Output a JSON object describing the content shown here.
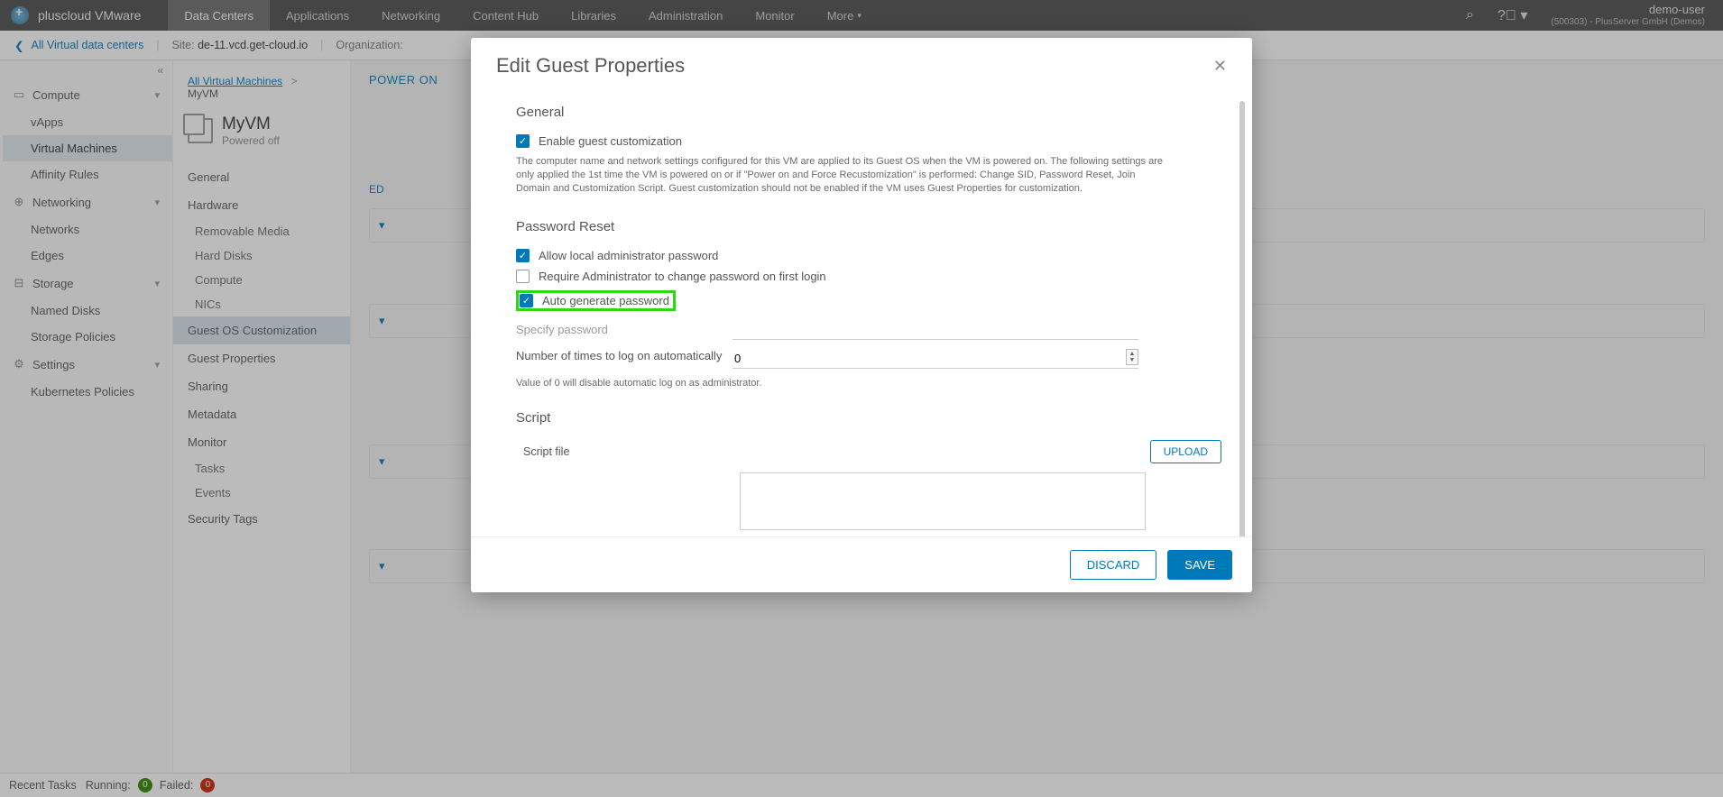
{
  "brand": "pluscloud VMware",
  "nav": {
    "tabs": [
      "Data Centers",
      "Applications",
      "Networking",
      "Content Hub",
      "Libraries",
      "Administration",
      "Monitor",
      "More"
    ],
    "active_index": 0,
    "user": {
      "name": "demo-user",
      "org": "(500303) - PlusServer GmbH (Demos)"
    }
  },
  "subheader": {
    "back_label": "All Virtual data centers",
    "site_label": "Site:",
    "site_value": "de-11.vcd.get-cloud.io",
    "org_label": "Organization:"
  },
  "sidebar": {
    "groups": [
      {
        "label": "Compute",
        "icon": "⬚",
        "items": [
          "vApps",
          "Virtual Machines",
          "Affinity Rules"
        ],
        "active": "Virtual Machines"
      },
      {
        "label": "Networking",
        "icon": "⊕",
        "items": [
          "Networks",
          "Edges"
        ]
      },
      {
        "label": "Storage",
        "icon": "⊟",
        "items": [
          "Named Disks",
          "Storage Policies"
        ]
      },
      {
        "label": "Settings",
        "icon": "⚙",
        "items": [
          "Kubernetes Policies"
        ]
      }
    ]
  },
  "vmnav": {
    "crumb_root": "All Virtual Machines",
    "crumb_leaf": "MyVM",
    "vm_name": "MyVM",
    "vm_state": "Powered off",
    "sections": {
      "general": "General",
      "hardware": "Hardware",
      "hardware_items": [
        "Removable Media",
        "Hard Disks",
        "Compute",
        "NICs"
      ],
      "guest_os": "Guest OS Customization",
      "guest_props": "Guest Properties",
      "sharing": "Sharing",
      "metadata": "Metadata",
      "monitor": "Monitor",
      "monitor_items": [
        "Tasks",
        "Events"
      ],
      "security": "Security Tags"
    }
  },
  "content": {
    "power_on": "POWER ON",
    "edit": "ED"
  },
  "modal": {
    "title": "Edit Guest Properties",
    "close": "✕",
    "sections": {
      "general": "General",
      "password": "Password Reset",
      "script": "Script"
    },
    "general": {
      "enable_label": "Enable guest customization",
      "enable_checked": true,
      "help": "The computer name and network settings configured for this VM are applied to its Guest OS when the VM is powered on. The following settings are only applied the 1st time the VM is powered on or if \"Power on and Force Recustomization\" is performed: Change SID, Password Reset, Join Domain and Customization Script. Guest customization should not be enabled if the VM uses Guest Properties for customization."
    },
    "password": {
      "allow_local": {
        "label": "Allow local administrator password",
        "checked": true
      },
      "require_change": {
        "label": "Require Administrator to change password on first login",
        "checked": false
      },
      "auto_gen": {
        "label": "Auto generate password",
        "checked": true
      },
      "specify_label": "Specify password",
      "specify_value": "",
      "auto_logon_label": "Number of times to log on automatically",
      "auto_logon_value": "0",
      "auto_logon_help": "Value of 0 will disable automatic log on as administrator."
    },
    "script": {
      "file_label": "Script file",
      "upload": "UPLOAD",
      "content": ""
    },
    "buttons": {
      "discard": "DISCARD",
      "save": "SAVE"
    }
  },
  "footer": {
    "recent": "Recent Tasks",
    "running_label": "Running:",
    "running_count": "0",
    "failed_label": "Failed:",
    "failed_count": "0"
  }
}
